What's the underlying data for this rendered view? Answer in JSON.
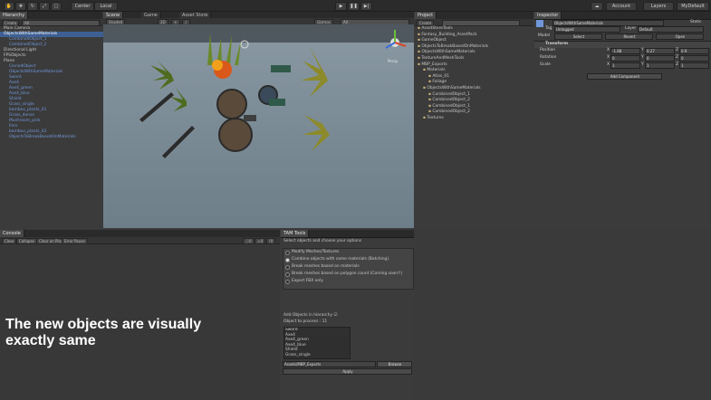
{
  "toolbar": {
    "center_label": "Center",
    "local_label": "Local",
    "account_label": "Account",
    "layers_label": "Layers",
    "layout_label": "MyDefault"
  },
  "hierarchy": {
    "tab": "Hierarchy",
    "create_label": "Create",
    "search_placeholder": "All",
    "items": [
      {
        "label": "Main Camera",
        "style": "normal"
      },
      {
        "label": "ObjectsWithSameMaterials",
        "style": "selected"
      },
      {
        "label": "CombinedObject_1",
        "style": "blue"
      },
      {
        "label": "CombinedObject_2",
        "style": "blue"
      },
      {
        "label": "Directional Light",
        "style": "normal"
      },
      {
        "label": "FPSObjects",
        "style": "normal"
      },
      {
        "label": "Plane",
        "style": "normal"
      },
      {
        "label": "ClonedObject",
        "style": "blue"
      },
      {
        "label": "ObjectsWithSameMaterials",
        "style": "blue"
      },
      {
        "label": "Sword",
        "style": "blue"
      },
      {
        "label": "Axe4",
        "style": "blue"
      },
      {
        "label": "Axe4_green",
        "style": "blue"
      },
      {
        "label": "Axe4_blue",
        "style": "blue"
      },
      {
        "label": "Shield",
        "style": "blue"
      },
      {
        "label": "Grass_single",
        "style": "blue"
      },
      {
        "label": "bamboo_plants_01",
        "style": "blue"
      },
      {
        "label": "Grass_dense",
        "style": "blue"
      },
      {
        "label": "Mushroom_pink",
        "style": "blue"
      },
      {
        "label": "Fern",
        "style": "blue"
      },
      {
        "label": "bamboo_plants_02",
        "style": "blue"
      },
      {
        "label": "ObjectsToBreakBasedOnMaterials",
        "style": "blue"
      }
    ]
  },
  "scene": {
    "tabs": [
      "Scene",
      "Game",
      "Asset Store"
    ],
    "shading_label": "Shaded",
    "gizmos_label": "Gizmos",
    "search_placeholder": "All",
    "persp_label": "Persp"
  },
  "project": {
    "tab": "Project",
    "create_label": "Create",
    "items": [
      {
        "label": "AssetStoreTools",
        "indent": 0
      },
      {
        "label": "Fantasy_Building_AssetPack",
        "indent": 0
      },
      {
        "label": "GameObject",
        "indent": 0
      },
      {
        "label": "ObjectsToBreakBasedOnMaterials",
        "indent": 0
      },
      {
        "label": "ObjectsWithSameMaterials",
        "indent": 0
      },
      {
        "label": "TextureAndMeshTools",
        "indent": 0
      },
      {
        "label": "MBP_Exports",
        "indent": 0
      },
      {
        "label": "Materials",
        "indent": 1
      },
      {
        "label": "Atlas_01",
        "indent": 2
      },
      {
        "label": "Foliage",
        "indent": 2
      },
      {
        "label": "ObjectsWithSameMaterials",
        "indent": 1
      },
      {
        "label": "CombinedObject_1",
        "indent": 2
      },
      {
        "label": "CombinedObject_2",
        "indent": 2
      },
      {
        "label": "CombinedObject_1",
        "indent": 2
      },
      {
        "label": "CombinedObject_2",
        "indent": 2
      },
      {
        "label": "Textures",
        "indent": 1
      }
    ]
  },
  "inspector": {
    "tab": "Inspector",
    "object_name": "ObjectsWithSameMaterials",
    "static_label": "Static",
    "tag_label": "Tag",
    "tag_value": "Untagged",
    "layer_label": "Layer",
    "layer_value": "Default",
    "model_label": "Model",
    "model_buttons": [
      "Select",
      "Revert",
      "Open"
    ],
    "transform_label": "Transform",
    "position_label": "Position",
    "rotation_label": "Rotation",
    "scale_label": "Scale",
    "position": {
      "x": "-1.88",
      "y": "0.27",
      "z": "0.9"
    },
    "rotation": {
      "x": "0",
      "y": "0",
      "z": "0"
    },
    "scale": {
      "x": "1",
      "y": "1",
      "z": "1"
    },
    "add_component": "Add Component"
  },
  "console": {
    "tab": "Console",
    "buttons": [
      "Clear",
      "Collapse",
      "Clear on Play",
      "Error Pause"
    ],
    "counts": [
      "0",
      "0",
      "0"
    ]
  },
  "tools": {
    "tab": "TAM Tools",
    "subtitle": "Select objects and choose your options",
    "options": [
      {
        "label": "Modify Meshes/Textures",
        "selected": false
      },
      {
        "label": "Combine objects with same materials (Batching)",
        "selected": true
      },
      {
        "label": "Break meshes based on materials",
        "selected": false
      },
      {
        "label": "Break meshes based on polygon count (Coming soon!!)",
        "selected": false
      },
      {
        "label": "Export FBX only",
        "selected": false
      }
    ],
    "add_objects_label": "Add Objects in hierarchy",
    "object_process_label": "Object to process : 11",
    "process_list": [
      "Sword",
      "Axe4",
      "Axe4_green",
      "Axe4_blue",
      "Shield",
      "Grass_single"
    ],
    "path_value": "Assets/MBP_Exports",
    "browse_label": "Browse",
    "apply_label": "Apply"
  },
  "caption": {
    "line1": "The new objects are visually",
    "line2": "exactly same"
  }
}
